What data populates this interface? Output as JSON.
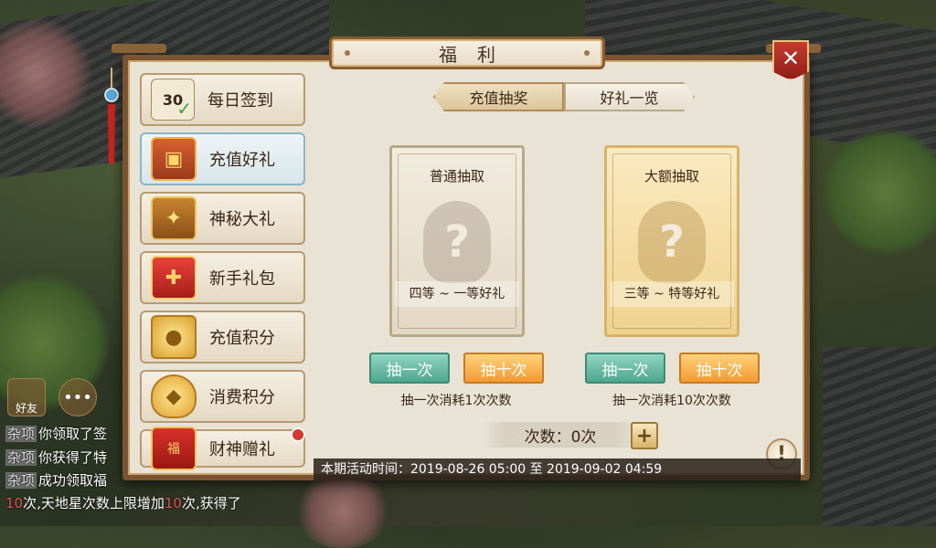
{
  "title": "福利",
  "close_label": "✕",
  "menu": [
    {
      "label": "每日签到",
      "icon": "calendar-icon",
      "active": false
    },
    {
      "label": "充值好礼",
      "icon": "treasure-chest-icon",
      "active": true
    },
    {
      "label": "神秘大礼",
      "icon": "mystery-chest-icon",
      "active": false
    },
    {
      "label": "新手礼包",
      "icon": "gift-box-icon",
      "active": false
    },
    {
      "label": "充值积分",
      "icon": "gold-chest-icon",
      "active": false
    },
    {
      "label": "消费积分",
      "icon": "gold-bag-icon",
      "active": false
    },
    {
      "label": "财神赠礼",
      "icon": "red-envelope-icon",
      "active": false,
      "badge": true
    }
  ],
  "calendar_number": "30",
  "tabs": [
    {
      "label": "充值抽奖",
      "active": true
    },
    {
      "label": "好礼一览",
      "active": false
    }
  ],
  "cards": [
    {
      "title": "普通抽取",
      "prize": "四等 ~ 一等好礼",
      "draw_once": "抽一次",
      "draw_ten": "抽十次",
      "cost": "抽一次消耗1次次数"
    },
    {
      "title": "大额抽取",
      "prize": "三等 ~ 特等好礼",
      "draw_once": "抽一次",
      "draw_ten": "抽十次",
      "cost": "抽一次消耗10次次数"
    }
  ],
  "count_text": "次数：0次",
  "plus_label": "+",
  "help_label": "!",
  "activity_time": "本期活动时间：2019-08-26 05:00 至 2019-09-02 04:59",
  "chat": {
    "friend_label": "好友",
    "lines": [
      {
        "tag": "杂项",
        "text": "你领取了签"
      },
      {
        "tag": "杂项",
        "text": "你获得了特"
      },
      {
        "tag": "杂项",
        "text": "成功领取福"
      }
    ],
    "bottom_line": {
      "n1": "10",
      "t1": "次,天地星次数上限增加",
      "n2": "10",
      "t2": "次,获得了"
    }
  },
  "colors": {
    "accent_red": "#d8382e",
    "frame_brown": "#7a5430",
    "green_button": "#4fa68e",
    "orange_button": "#f39a32"
  }
}
